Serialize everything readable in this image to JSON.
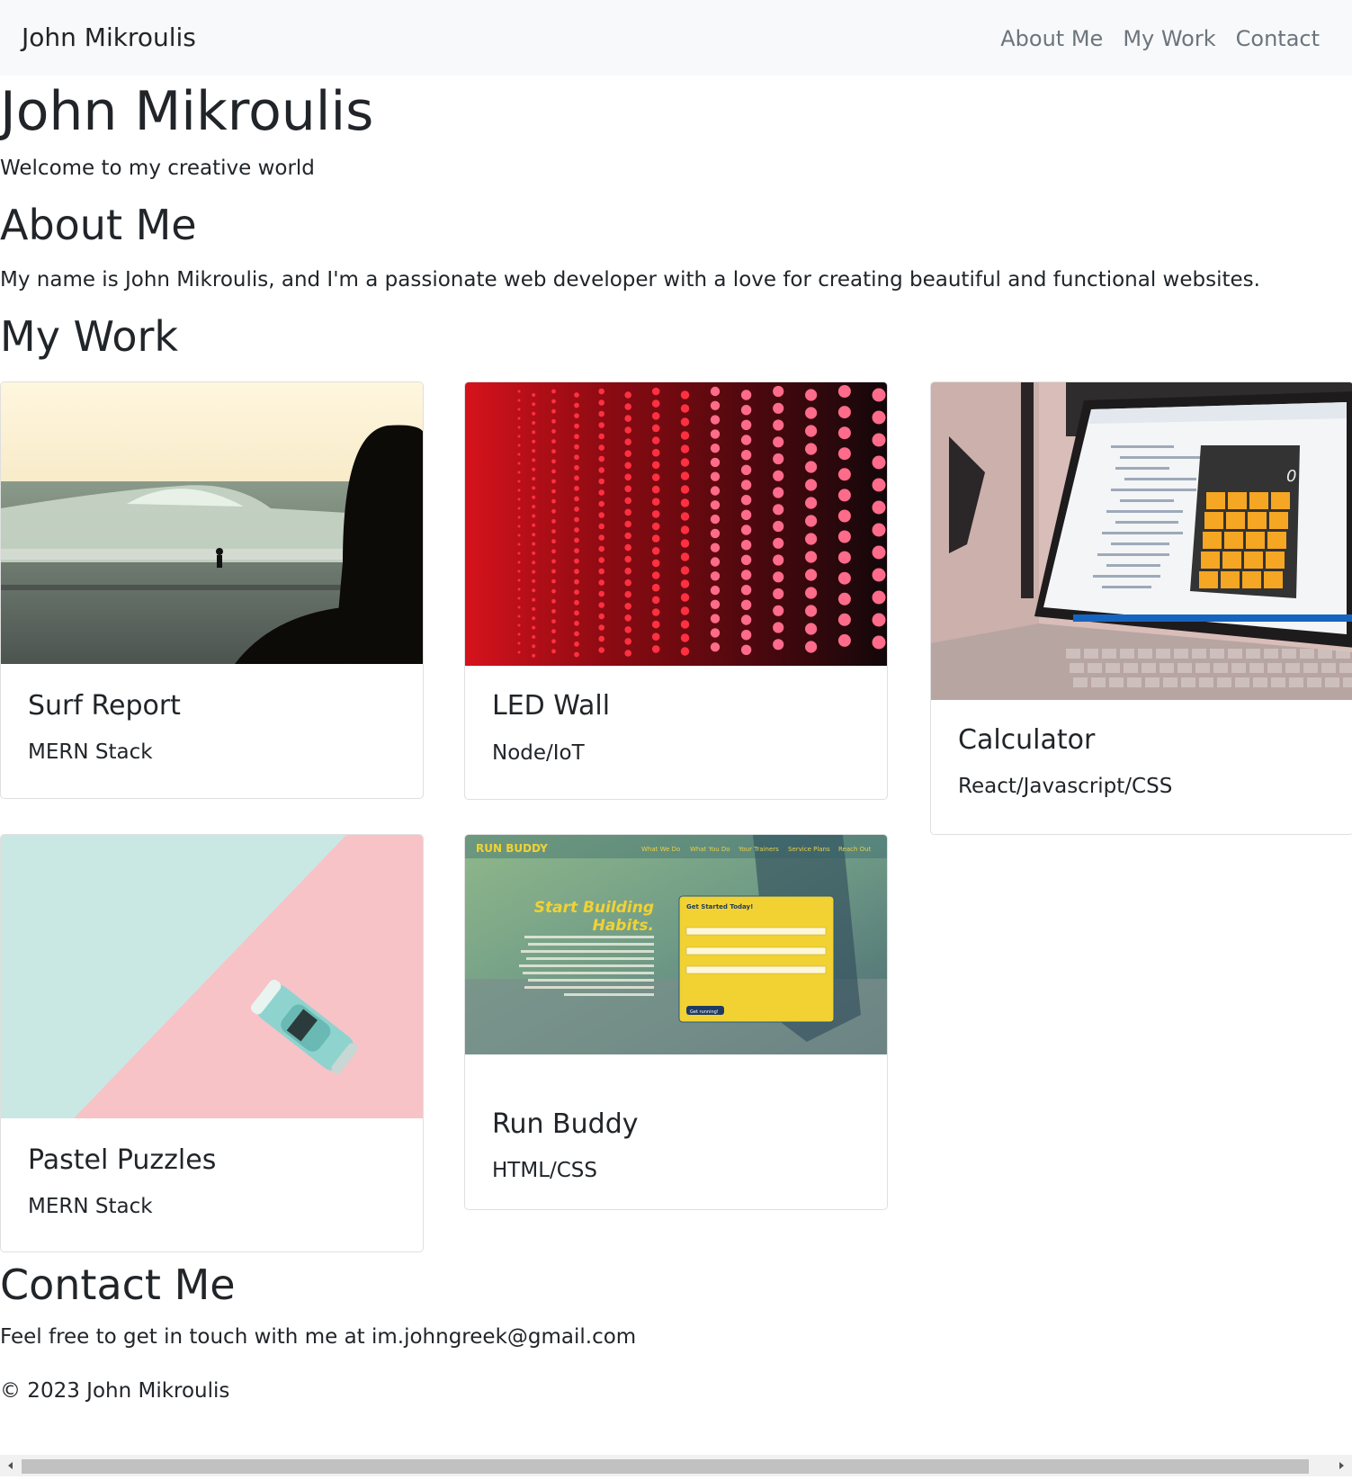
{
  "navbar": {
    "brand": "John Mikroulis",
    "links": [
      "About Me",
      "My Work",
      "Contact"
    ]
  },
  "hero": {
    "title": "John Mikroulis",
    "subtitle": "Welcome to my creative world"
  },
  "about": {
    "heading": "About Me",
    "text": "My name is John Mikroulis, and I'm a passionate web developer with a love for creating beautiful and functional websites."
  },
  "work": {
    "heading": "My Work",
    "projects": [
      {
        "title": "Surf Report",
        "subtitle": "MERN Stack"
      },
      {
        "title": "LED Wall",
        "subtitle": "Node/IoT"
      },
      {
        "title": "Calculator",
        "subtitle": "React/Javascript/CSS"
      },
      {
        "title": "Pastel Puzzles",
        "subtitle": "MERN Stack"
      },
      {
        "title": "Run Buddy",
        "subtitle": "HTML/CSS"
      }
    ]
  },
  "runbuddy_preview": {
    "logo": "RUN BUDDY",
    "nav": [
      "What We Do",
      "What You Do",
      "Your Trainers",
      "Service Plans",
      "Reach Out"
    ],
    "headline_1": "Start Building",
    "headline_2": "Habits.",
    "form_title": "Get Started Today!",
    "button": "Get running!"
  },
  "calculator_preview": {
    "display": "0"
  },
  "contact": {
    "heading": "Contact Me",
    "text": "Feel free to get in touch with me at im.johngreek@gmail.com"
  },
  "footer": {
    "copyright": "© 2023 John Mikroulis"
  }
}
